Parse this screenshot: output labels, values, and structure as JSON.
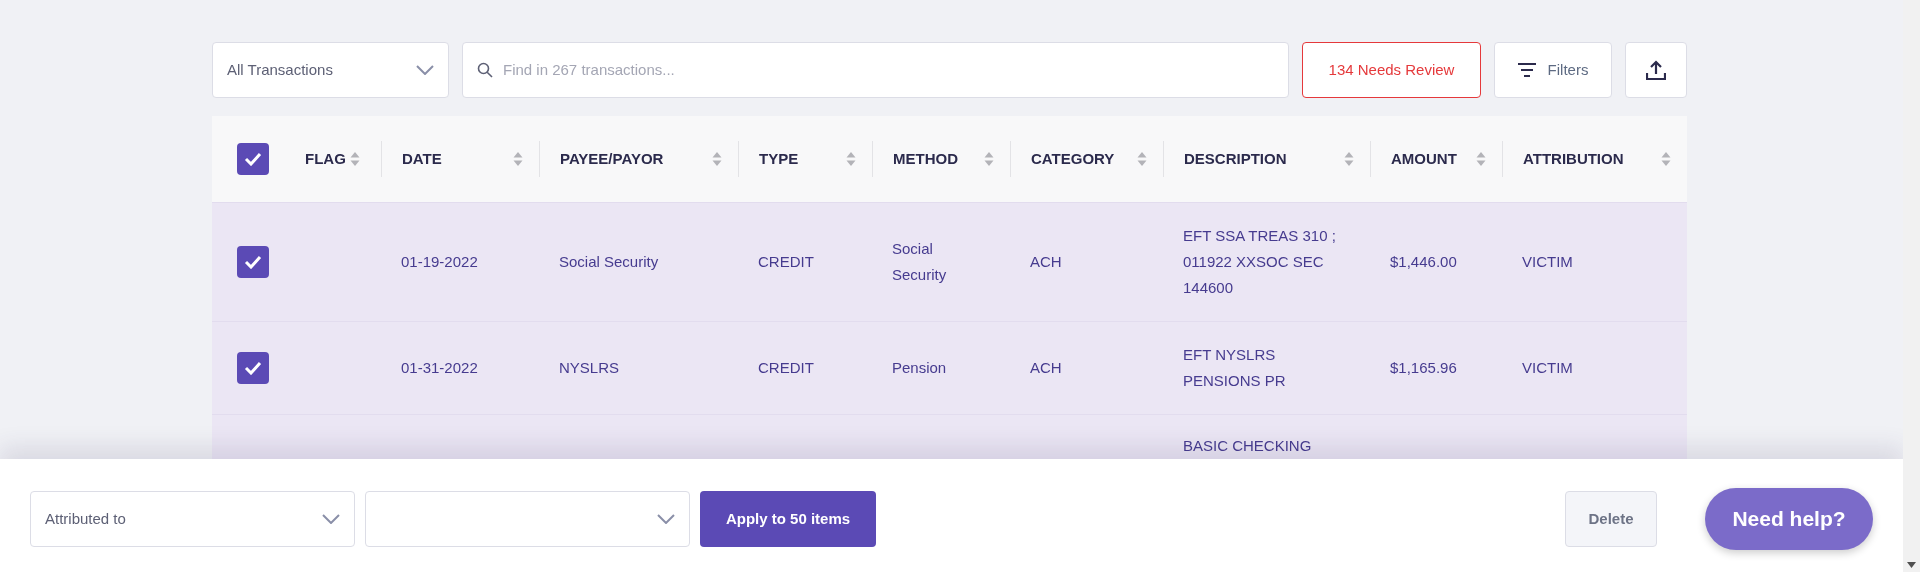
{
  "toolbar": {
    "view_select": {
      "value": "All Transactions"
    },
    "search": {
      "placeholder": "Find in 267 transactions..."
    },
    "review_button": "134 Needs Review",
    "filters_button": "Filters"
  },
  "table": {
    "select_all": {
      "checked": true
    },
    "columns": [
      "FLAG",
      "DATE",
      "PAYEE/PAYOR",
      "TYPE",
      "METHOD",
      "CATEGORY",
      "DESCRIPTION",
      "AMOUNT",
      "ATTRIBUTION"
    ],
    "rows": [
      {
        "checked": true,
        "date": "01-19-2022",
        "payee_payor": "Social Security",
        "type": "CREDIT",
        "method": "Social Security",
        "category": "ACH",
        "description": "EFT SSA TREAS 310 ; 011922 XXSOC SEC 144600",
        "amount": "$1,446.00",
        "attribution": "VICTIM"
      },
      {
        "checked": true,
        "date": "01-31-2022",
        "payee_payor": "NYSLRS",
        "type": "CREDIT",
        "method": "Pension",
        "category": "ACH",
        "description": "EFT NYSLRS PENSIONS PR",
        "amount": "$1,165.96",
        "attribution": "VICTIM"
      },
      {
        "description": "BASIC CHECKING"
      }
    ]
  },
  "bulk_bar": {
    "attribution_select": {
      "placeholder": "Attributed to"
    },
    "apply_button": "Apply to 50 items",
    "delete_button": "Delete"
  },
  "help_button": "Need help?"
}
